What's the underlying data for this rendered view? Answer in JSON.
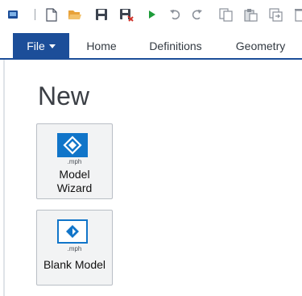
{
  "toolbar": {
    "icons": [
      "app-icon",
      "new-file-icon",
      "open-folder-icon",
      "save-icon",
      "save-as-icon",
      "run-icon",
      "undo-icon",
      "redo-icon",
      "copy-icon",
      "paste-icon",
      "duplicate-icon",
      "delete-icon"
    ]
  },
  "ribbon": {
    "file_label": "File",
    "tabs": [
      "Home",
      "Definitions",
      "Geometry"
    ]
  },
  "backstage": {
    "title": "New",
    "tiles": [
      {
        "ext": ".mph",
        "label_line1": "Model",
        "label_line2": "Wizard"
      },
      {
        "ext": ".mph",
        "label_line1": "Blank Model"
      }
    ]
  },
  "colors": {
    "accent": "#1c4e99",
    "icon_blue": "#1175c9",
    "run_green": "#1e9c3a",
    "folder_orange": "#e8a23a"
  }
}
